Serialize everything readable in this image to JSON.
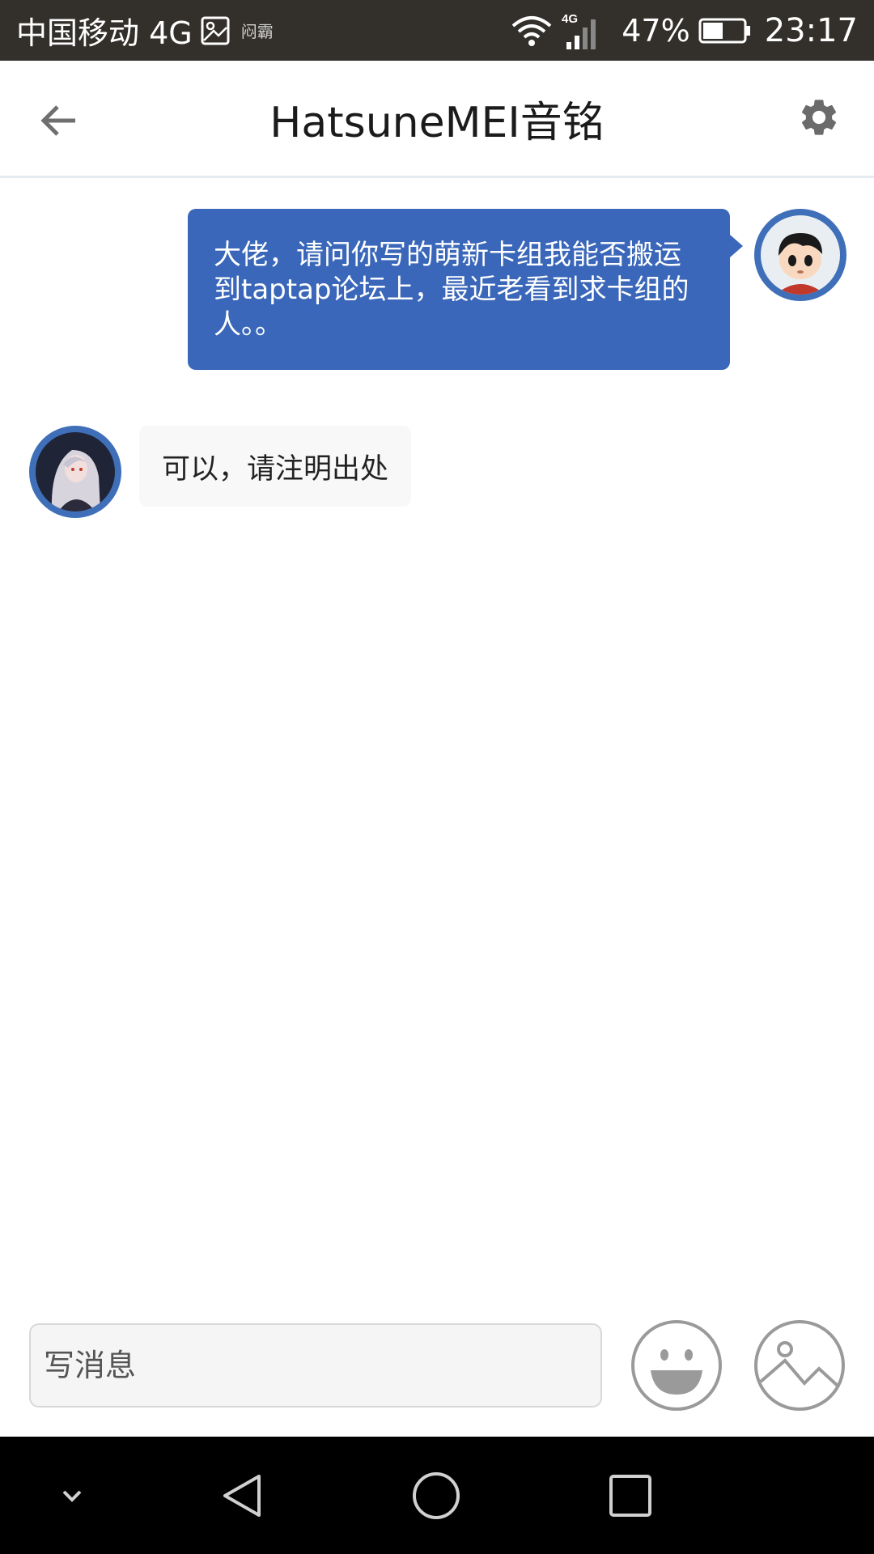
{
  "status_bar": {
    "carrier": "中国移动 4G",
    "small_text": "闷霸",
    "network": "4G",
    "battery_percent": "47%",
    "time": "23:17"
  },
  "header": {
    "title": "HatsuneMEI音铭",
    "back_icon": "arrow-left-icon",
    "settings_icon": "gear-icon"
  },
  "messages": [
    {
      "direction": "outgoing",
      "text": "大佬，请问你写的萌新卡组我能否搬运到taptap论坛上，最近老看到求卡组的人。。"
    },
    {
      "direction": "incoming",
      "text": "可以，请注明出处"
    }
  ],
  "composer": {
    "placeholder": "写消息",
    "emoji_icon": "smiley-icon",
    "image_icon": "image-icon"
  },
  "nav_bar": {
    "icons": [
      "chevron-down-icon",
      "back-triangle-icon",
      "home-circle-icon",
      "recents-square-icon"
    ]
  },
  "colors": {
    "accent": "#3a67b9",
    "status_bar_bg": "#33302b",
    "incoming_bubble": "#f8f8f8"
  }
}
